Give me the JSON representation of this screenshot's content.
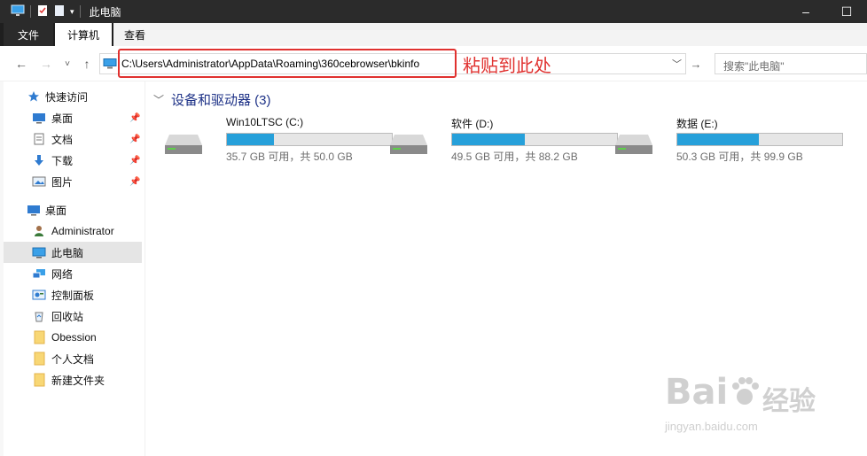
{
  "window": {
    "title": "此电脑",
    "controls": {
      "minimize": "–",
      "maximize": "☐"
    }
  },
  "ribbon": {
    "tabs": [
      {
        "label": "文件"
      },
      {
        "label": "计算机"
      },
      {
        "label": "查看"
      }
    ]
  },
  "nav": {
    "back": "←",
    "forward": "→",
    "recent": "˅",
    "up": "↑",
    "address": "C:\\Users\\Administrator\\AppData\\Roaming\\360cebrowser\\bkinfo",
    "address_dropdown": "﹀",
    "go": "→",
    "search_placeholder": "搜索\"此电脑\""
  },
  "annotation": {
    "text": "粘贴到此处",
    "color": "#e0312f"
  },
  "sidebar": {
    "items": [
      {
        "label": "快速访问",
        "icon": "star-icon",
        "pinned": false
      },
      {
        "label": "桌面",
        "icon": "desktop-icon",
        "pinned": true
      },
      {
        "label": "文档",
        "icon": "documents-icon",
        "pinned": true
      },
      {
        "label": "下载",
        "icon": "download-icon",
        "pinned": true
      },
      {
        "label": "图片",
        "icon": "pictures-icon",
        "pinned": true
      },
      {
        "label": "桌面",
        "icon": "desktop-icon",
        "pinned": false
      },
      {
        "label": "Administrator",
        "icon": "user-icon",
        "pinned": false
      },
      {
        "label": "此电脑",
        "icon": "computer-icon",
        "pinned": false,
        "selected": true
      },
      {
        "label": "网络",
        "icon": "network-icon",
        "pinned": false
      },
      {
        "label": "控制面板",
        "icon": "control-panel-icon",
        "pinned": false
      },
      {
        "label": "回收站",
        "icon": "recycle-bin-icon",
        "pinned": false
      },
      {
        "label": "Obession",
        "icon": "folder-icon",
        "pinned": false
      },
      {
        "label": "个人文档",
        "icon": "folder-icon",
        "pinned": false
      },
      {
        "label": "新建文件夹",
        "icon": "folder-icon",
        "pinned": false
      }
    ]
  },
  "main": {
    "group_title": "设备和驱动器 (3)",
    "drives": [
      {
        "name": "Win10LTSC (C:)",
        "info": "35.7 GB 可用，共 50.0 GB",
        "used_fraction": 0.286
      },
      {
        "name": "软件 (D:)",
        "info": "49.5 GB 可用，共 88.2 GB",
        "used_fraction": 0.439
      },
      {
        "name": "数据 (E:)",
        "info": "50.3 GB 可用，共 99.9 GB",
        "used_fraction": 0.496
      }
    ]
  },
  "watermark": {
    "brand": "Bai",
    "brand_cn": "经验",
    "url": "jingyan.baidu.com"
  },
  "colors": {
    "accent": "#26a0da",
    "title_bar": "#2b2b2b",
    "selection": "#e5e5e5",
    "group_header": "#1e3287"
  }
}
